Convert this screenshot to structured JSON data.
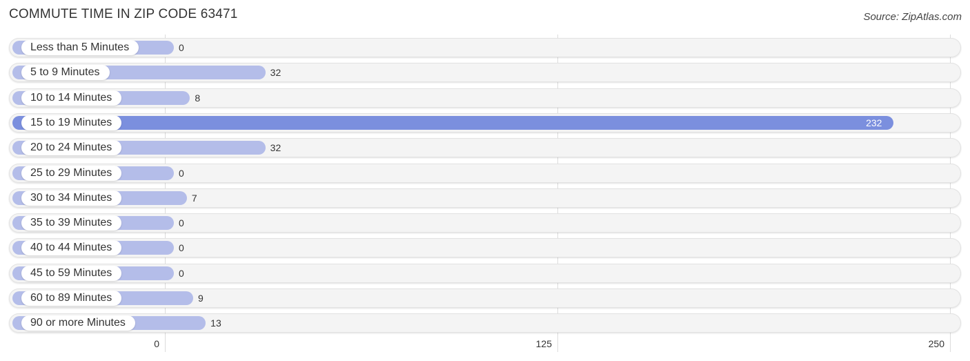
{
  "title": "COMMUTE TIME IN ZIP CODE 63471",
  "source": "Source: ZipAtlas.com",
  "chart_data": {
    "type": "bar",
    "orientation": "horizontal",
    "title": "COMMUTE TIME IN ZIP CODE 63471",
    "source": "Source: ZipAtlas.com",
    "categories": [
      "Less than 5 Minutes",
      "5 to 9 Minutes",
      "10 to 14 Minutes",
      "15 to 19 Minutes",
      "20 to 24 Minutes",
      "25 to 29 Minutes",
      "30 to 34 Minutes",
      "35 to 39 Minutes",
      "40 to 44 Minutes",
      "45 to 59 Minutes",
      "60 to 89 Minutes",
      "90 or more Minutes"
    ],
    "values": [
      0,
      32,
      8,
      232,
      32,
      0,
      7,
      0,
      0,
      0,
      9,
      13
    ],
    "xlim": [
      0,
      250
    ],
    "xticks": [
      0,
      125,
      250
    ],
    "xlabel": "",
    "ylabel": "",
    "grid": true,
    "highlight_index": 3,
    "colors": {
      "bar": "#b4bde9",
      "highlight": "#7b8fde"
    }
  }
}
